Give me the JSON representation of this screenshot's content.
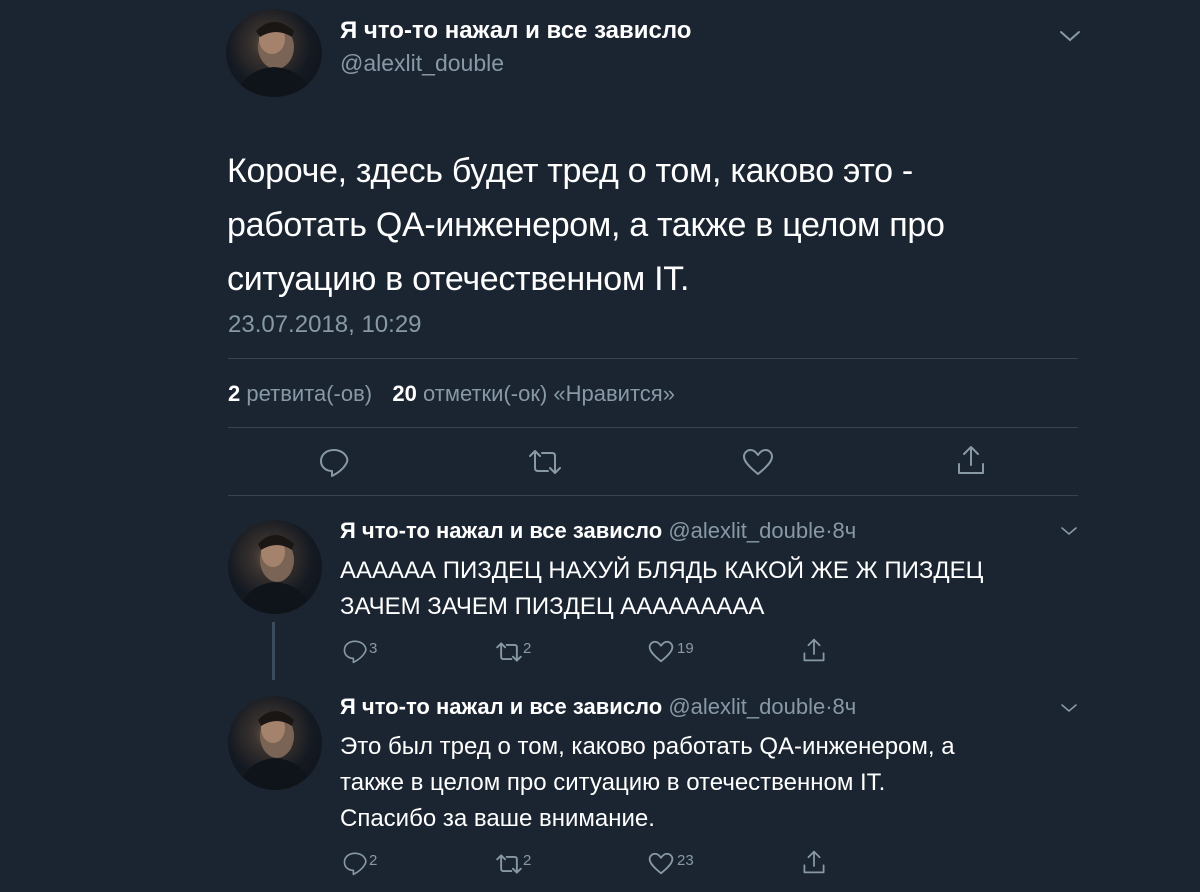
{
  "main_tweet": {
    "display_name": "Я что-то нажал и все зависло",
    "handle": "@alexlit_double",
    "text_lines": [
      "Короче, здесь будет тред о том, каково это -",
      "работать QA-инженером, а также в целом про",
      "ситуацию в отечественном IT."
    ],
    "timestamp": "23.07.2018, 10:29",
    "retweets_count": "2",
    "retweets_label": "ретвита(-ов)",
    "likes_count": "20",
    "likes_label": "отметки(-ок) «Нравится»"
  },
  "replies": [
    {
      "display_name": "Я что-то нажал и все зависло",
      "handle": "@alexlit_double",
      "dot": "·",
      "time": "8ч",
      "text_lines": [
        "АААААА ПИЗДЕЦ НАХУЙ БЛЯДЬ КАКОЙ ЖЕ Ж ПИЗДЕЦ",
        "ЗАЧЕМ ЗАЧЕМ ПИЗДЕЦ ААААААААА"
      ],
      "reply_count": "3",
      "retweet_count": "2",
      "like_count": "19"
    },
    {
      "display_name": "Я что-то нажал и все зависло",
      "handle": "@alexlit_double",
      "dot": "·",
      "time": "8ч",
      "text_lines": [
        "Это был тред о том, каково работать QA-инженером, а",
        "также в целом про ситуацию в отечественном IT.",
        "Спасибо за ваше внимание."
      ],
      "reply_count": "2",
      "retweet_count": "2",
      "like_count": "23"
    }
  ],
  "icons": {
    "more": "chevron-down-icon",
    "reply": "speech-bubble-icon",
    "retweet": "retweet-arrows-icon",
    "like": "heart-icon",
    "share": "share-upload-icon"
  },
  "colors": {
    "background": "#1b2532",
    "text": "#ffffff",
    "secondary": "#8899a6",
    "divider": "#38444d"
  }
}
